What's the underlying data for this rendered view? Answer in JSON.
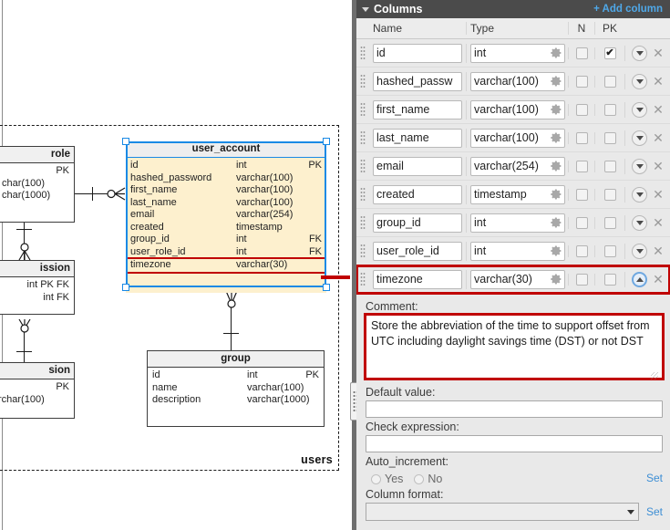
{
  "diagram": {
    "subject_area_label": "users",
    "entities": [
      {
        "id": "role",
        "name": "role",
        "attributes": [
          {
            "name": "",
            "type": "",
            "key": "PK"
          },
          {
            "name": "",
            "type": "char(100)",
            "key": ""
          },
          {
            "name": "",
            "type": "char(1000)",
            "key": ""
          }
        ]
      },
      {
        "id": "permission",
        "name": "ission",
        "attributes": [
          {
            "name": "",
            "type": "int PK FK",
            "key": ""
          },
          {
            "name": "",
            "type": "int FK",
            "key": ""
          }
        ]
      },
      {
        "id": "session",
        "name": "sion",
        "attributes": [
          {
            "name": "",
            "type": "",
            "key": "PK"
          },
          {
            "name": "",
            "type": "rchar(100)",
            "key": ""
          }
        ]
      },
      {
        "id": "user_account",
        "name": "user_account",
        "attributes": [
          {
            "name": "id",
            "type": "int",
            "key": "PK"
          },
          {
            "name": "hashed_password",
            "type": "varchar(100)",
            "key": ""
          },
          {
            "name": "first_name",
            "type": "varchar(100)",
            "key": ""
          },
          {
            "name": "last_name",
            "type": "varchar(100)",
            "key": ""
          },
          {
            "name": "email",
            "type": "varchar(254)",
            "key": ""
          },
          {
            "name": "created",
            "type": "timestamp",
            "key": ""
          },
          {
            "name": "group_id",
            "type": "int",
            "key": "FK"
          },
          {
            "name": "user_role_id",
            "type": "int",
            "key": "FK"
          },
          {
            "name": "timezone",
            "type": "varchar(30)",
            "key": ""
          }
        ]
      },
      {
        "id": "group",
        "name": "group",
        "attributes": [
          {
            "name": "id",
            "type": "int",
            "key": "PK"
          },
          {
            "name": "name",
            "type": "varchar(100)",
            "key": ""
          },
          {
            "name": "description",
            "type": "varchar(1000)",
            "key": ""
          }
        ]
      }
    ]
  },
  "panel": {
    "title": "Columns",
    "add_column_label": "+ Add column",
    "collapse_icon": "chevron-down-icon",
    "grid_headers": {
      "name": "Name",
      "type": "Type",
      "n": "N",
      "pk": "PK"
    },
    "rows": [
      {
        "name": "id",
        "type": "int",
        "n": false,
        "pk": true,
        "expanded": false
      },
      {
        "name": "hashed_passw",
        "type": "varchar(100)",
        "n": false,
        "pk": false,
        "expanded": false
      },
      {
        "name": "first_name",
        "type": "varchar(100)",
        "n": false,
        "pk": false,
        "expanded": false
      },
      {
        "name": "last_name",
        "type": "varchar(100)",
        "n": false,
        "pk": false,
        "expanded": false
      },
      {
        "name": "email",
        "type": "varchar(254)",
        "n": false,
        "pk": false,
        "expanded": false
      },
      {
        "name": "created",
        "type": "timestamp",
        "n": false,
        "pk": false,
        "expanded": false
      },
      {
        "name": "group_id",
        "type": "int",
        "n": false,
        "pk": false,
        "expanded": false
      },
      {
        "name": "user_role_id",
        "type": "int",
        "n": false,
        "pk": false,
        "expanded": false
      },
      {
        "name": "timezone",
        "type": "varchar(30)",
        "n": false,
        "pk": false,
        "expanded": true
      }
    ],
    "details": {
      "comment_label": "Comment:",
      "comment_value": "Store the abbreviation of the time to support offset from UTC including daylight savings time (DST) or not DST",
      "default_value_label": "Default value:",
      "default_value": "",
      "check_expression_label": "Check expression:",
      "check_expression": "",
      "auto_increment_label": "Auto_increment:",
      "auto_increment_yes": "Yes",
      "auto_increment_no": "No",
      "auto_increment_set": "Set",
      "column_format_label": "Column format:",
      "column_format_value": "",
      "column_format_set": "Set"
    }
  },
  "colors": {
    "accent_blue": "#1a8ae5",
    "highlight_red": "#c00000",
    "entity_fill": "#fdf0ce",
    "panel_header": "#4b4b4b",
    "link_blue": "#4fa8e8"
  }
}
